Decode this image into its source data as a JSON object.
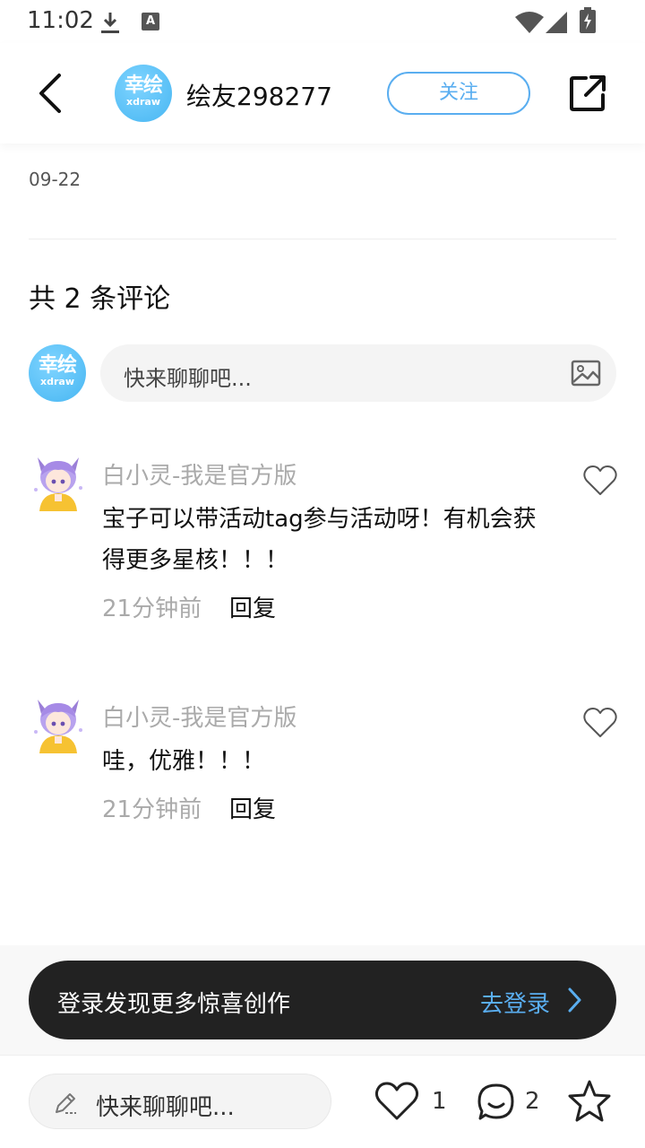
{
  "status_bar": {
    "time": "11:02",
    "a_badge": "A"
  },
  "header": {
    "logo_main": "幸绘",
    "logo_sub": "xdraw",
    "username": "绘友298277",
    "follow_label": "关注"
  },
  "post": {
    "date": "09-22"
  },
  "comments_section": {
    "count_label": "共 2 条评论",
    "composer_placeholder": "快来聊聊吧...",
    "items": [
      {
        "author": "白小灵-我是官方版",
        "text": "宝子可以带活动tag参与活动呀！有机会获得更多星核！！！",
        "time": "21分钟前",
        "reply_label": "回复"
      },
      {
        "author": "白小灵-我是官方版",
        "text": "哇，优雅！！！",
        "time": "21分钟前",
        "reply_label": "回复"
      }
    ]
  },
  "login_banner": {
    "text": "登录发现更多惊喜创作",
    "link": "去登录"
  },
  "bottom_bar": {
    "placeholder": "快来聊聊吧...",
    "like_count": "1",
    "comment_count": "2"
  },
  "colors": {
    "accent": "#5aaef0",
    "banner_bg": "#222222",
    "muted_text": "#aaaaaa"
  }
}
